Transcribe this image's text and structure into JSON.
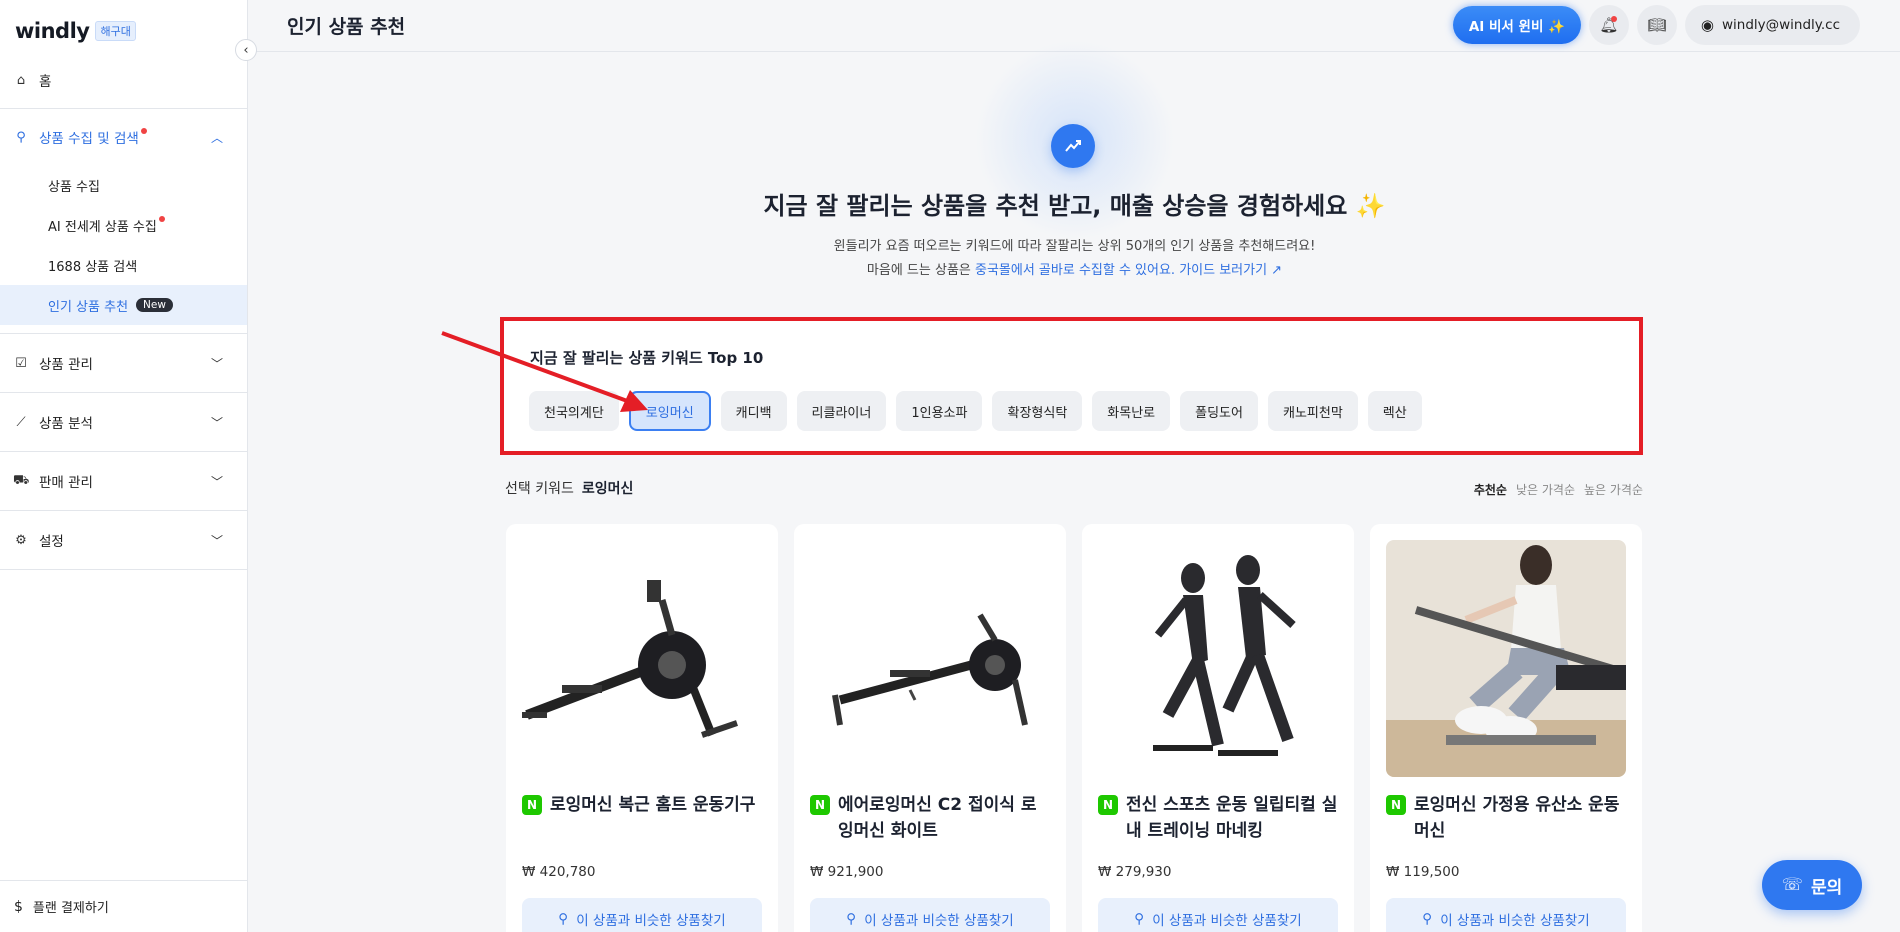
{
  "sidebar": {
    "logo": "windly",
    "logo_badge": "해구대",
    "home": "홈",
    "search_group": {
      "label": "상품 수집 및 검색",
      "items": [
        {
          "label": "상품 수집"
        },
        {
          "label": "AI 전세계 상품 수집"
        },
        {
          "label": "1688 상품 검색"
        },
        {
          "label": "인기 상품 추천",
          "badge": "New"
        }
      ]
    },
    "groups": [
      {
        "label": "상품 관리"
      },
      {
        "label": "상품 분석"
      },
      {
        "label": "판매 관리"
      },
      {
        "label": "설정"
      }
    ],
    "footer": "플랜 결제하기"
  },
  "header": {
    "title": "인기 상품 추천",
    "ai_button": "AI 비서 윈비 ✨",
    "user": "windly@windly.cc"
  },
  "hero": {
    "title": "지금 잘 팔리는 상품을 추천 받고, 매출 상승을 경험하세요 ✨",
    "desc_line1": "윈들리가 요즘 떠오르는 키워드에 따라 잘팔리는 상위 50개의 인기 상품을 추천해드려요!",
    "desc_line2_prefix": "마음에 드는 상품은 ",
    "desc_line2_link": "중국몰에서 골바로 수집할 수 있어요. 가이드 보러가기 ↗"
  },
  "keywords": {
    "title": "지금 잘 팔리는 상품 키워드 Top 10",
    "items": [
      "천국의계단",
      "로잉머신",
      "캐디백",
      "리클라이너",
      "1인용소파",
      "확장형식탁",
      "화목난로",
      "폴딩도어",
      "캐노피천막",
      "렉산"
    ],
    "selected_index": 1
  },
  "selection": {
    "label": "선택 키워드",
    "value": "로잉머신",
    "sort": [
      "추천순",
      "낮은 가격순",
      "높은 가격순"
    ]
  },
  "products": [
    {
      "name": "로잉머신 복근 홈트 운동기구",
      "price": "₩ 420,780",
      "button": "이 상품과 비슷한 상품찾기"
    },
    {
      "name": "에어로잉머신 C2 접이식 로잉머신 화이트",
      "price": "₩ 921,900",
      "button": "이 상품과 비슷한 상품찾기"
    },
    {
      "name": "전신 스포츠 운동 일립티컬 실내 트레이닝 마네킹",
      "price": "₩ 279,930",
      "button": "이 상품과 비슷한 상품찾기"
    },
    {
      "name": "로잉머신 가정용 유산소 운동머신",
      "price": "₩ 119,500",
      "button": "이 상품과 비슷한 상품찾기"
    }
  ],
  "inquiry": "문의",
  "colors": {
    "accent": "#2f78f0",
    "highlight_box": "#e41e26",
    "naver_badge": "#1ec800"
  }
}
